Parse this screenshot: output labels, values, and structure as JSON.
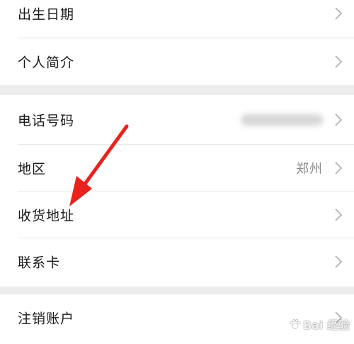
{
  "groups": [
    {
      "rows": [
        {
          "label": "出生日期"
        },
        {
          "label": "个人简介"
        }
      ]
    },
    {
      "rows": [
        {
          "label": "电话号码",
          "value_blurred": true
        },
        {
          "label": "地区",
          "value": "郑州"
        },
        {
          "label": "收货地址"
        },
        {
          "label": "联系卡"
        }
      ]
    },
    {
      "rows": [
        {
          "label": "注销账户"
        }
      ]
    }
  ],
  "annotation": {
    "arrow_color": "#e8221d",
    "points_to": "收货地址"
  },
  "watermark": {
    "text": "Bai 经验"
  },
  "colors": {
    "background": "#ededed",
    "row_background": "#ffffff",
    "label": "#1a1a1a",
    "secondary": "#8c8c8c",
    "chevron": "#b2b2b2"
  }
}
